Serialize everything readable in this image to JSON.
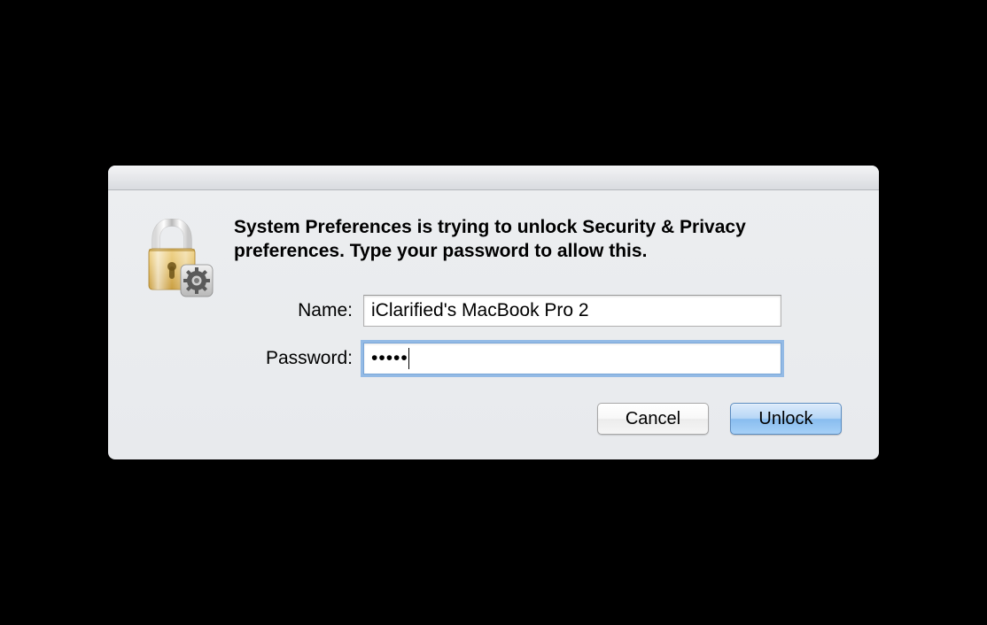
{
  "dialog": {
    "message": "System Preferences is trying to unlock Security & Privacy preferences. Type your password to allow this.",
    "name_label": "Name:",
    "name_value": "iClarified's MacBook Pro 2",
    "password_label": "Password:",
    "password_value_masked": "•••••",
    "cancel_label": "Cancel",
    "unlock_label": "Unlock",
    "icons": {
      "lock": "lock-icon",
      "gear": "gear-icon"
    }
  }
}
